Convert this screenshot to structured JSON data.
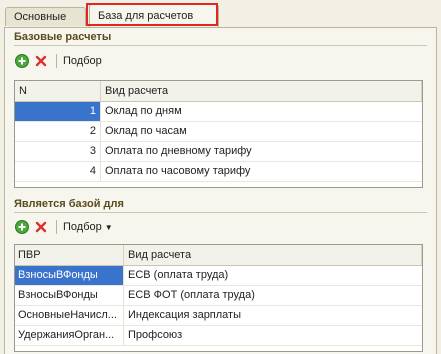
{
  "tabs": [
    {
      "label": "Основные"
    },
    {
      "label": "База для расчетов"
    }
  ],
  "section1": {
    "title": "Базовые расчеты",
    "toolbar": {
      "pick_label": "Подбор"
    },
    "columns": [
      "N",
      "Вид расчета"
    ],
    "rows": [
      {
        "n": "1",
        "vid": "Оклад по дням"
      },
      {
        "n": "2",
        "vid": "Оклад по часам"
      },
      {
        "n": "3",
        "vid": "Оплата по дневному тарифу"
      },
      {
        "n": "4",
        "vid": "Оплата по часовому тарифу"
      }
    ]
  },
  "section2": {
    "title": "Является базой для",
    "toolbar": {
      "pick_label": "Подбор"
    },
    "columns": [
      "ПВР",
      "Вид расчета"
    ],
    "rows": [
      {
        "pvr": "ВзносыВФонды",
        "vid": "ЕСВ (оплата труда)"
      },
      {
        "pvr": "ВзносыВФонды",
        "vid": "ЕСВ ФОТ (оплата труда)"
      },
      {
        "pvr": "ОсновныеНачисл...",
        "vid": "Индексация зарплаты"
      },
      {
        "pvr": "УдержанияОрган...",
        "vid": "Профсоюз"
      }
    ]
  },
  "colors": {
    "selection": "#3a73cc",
    "highlight": "#e0281e",
    "title": "#5b4a1c"
  }
}
